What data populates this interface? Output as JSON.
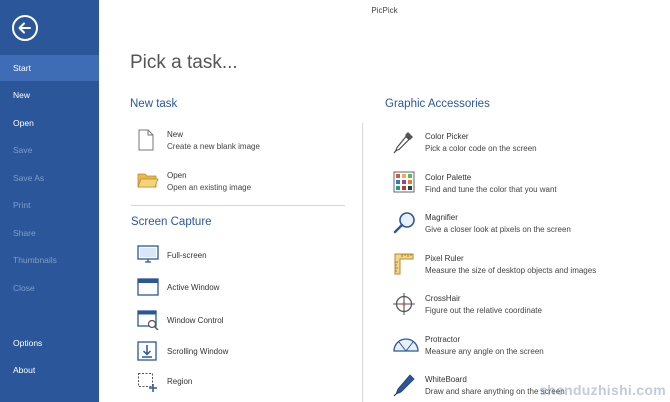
{
  "app": {
    "title": "PicPick"
  },
  "sidebar": {
    "items": [
      {
        "label": "Start",
        "state": "active"
      },
      {
        "label": "New",
        "state": "enabled"
      },
      {
        "label": "Open",
        "state": "enabled"
      },
      {
        "label": "Save",
        "state": "disabled"
      },
      {
        "label": "Save As",
        "state": "disabled"
      },
      {
        "label": "Print",
        "state": "disabled"
      },
      {
        "label": "Share",
        "state": "disabled"
      },
      {
        "label": "Thumbnails",
        "state": "disabled"
      },
      {
        "label": "Close",
        "state": "disabled"
      },
      {
        "label": "Options",
        "state": "enabled"
      },
      {
        "label": "About",
        "state": "enabled"
      }
    ]
  },
  "main": {
    "heading": "Pick a task...",
    "new_task": {
      "title": "New task",
      "items": [
        {
          "title": "New",
          "desc": "Create a new blank image",
          "icon": "blank-page-icon"
        },
        {
          "title": "Open",
          "desc": "Open an existing image",
          "icon": "folder-open-icon"
        }
      ]
    },
    "screen_capture": {
      "title": "Screen Capture",
      "items": [
        {
          "title": "Full-screen",
          "icon": "monitor-icon"
        },
        {
          "title": "Active Window",
          "icon": "window-icon"
        },
        {
          "title": "Window Control",
          "icon": "window-control-icon"
        },
        {
          "title": "Scrolling Window",
          "icon": "scrolling-window-icon"
        },
        {
          "title": "Region",
          "icon": "region-icon"
        }
      ]
    },
    "graphic_accessories": {
      "title": "Graphic Accessories",
      "items": [
        {
          "title": "Color Picker",
          "desc": "Pick a color code on the screen",
          "icon": "eyedropper-icon"
        },
        {
          "title": "Color Palette",
          "desc": "Find and tune the color that you want",
          "icon": "palette-icon"
        },
        {
          "title": "Magnifier",
          "desc": "Give a closer look at pixels on the screen",
          "icon": "magnifier-icon"
        },
        {
          "title": "Pixel Ruler",
          "desc": "Measure the size of desktop objects and images",
          "icon": "ruler-icon"
        },
        {
          "title": "CrossHair",
          "desc": "Figure out the relative coordinate",
          "icon": "crosshair-icon"
        },
        {
          "title": "Protractor",
          "desc": "Measure any angle on the screen",
          "icon": "protractor-icon"
        },
        {
          "title": "WhiteBoard",
          "desc": "Draw and share anything on the screen",
          "icon": "pen-icon"
        }
      ]
    }
  },
  "watermark": "shenduzhishi.com",
  "colors": {
    "sidebar": "#2b579a",
    "sidebar_active": "#3e6db5",
    "accent": "#2b579a"
  }
}
